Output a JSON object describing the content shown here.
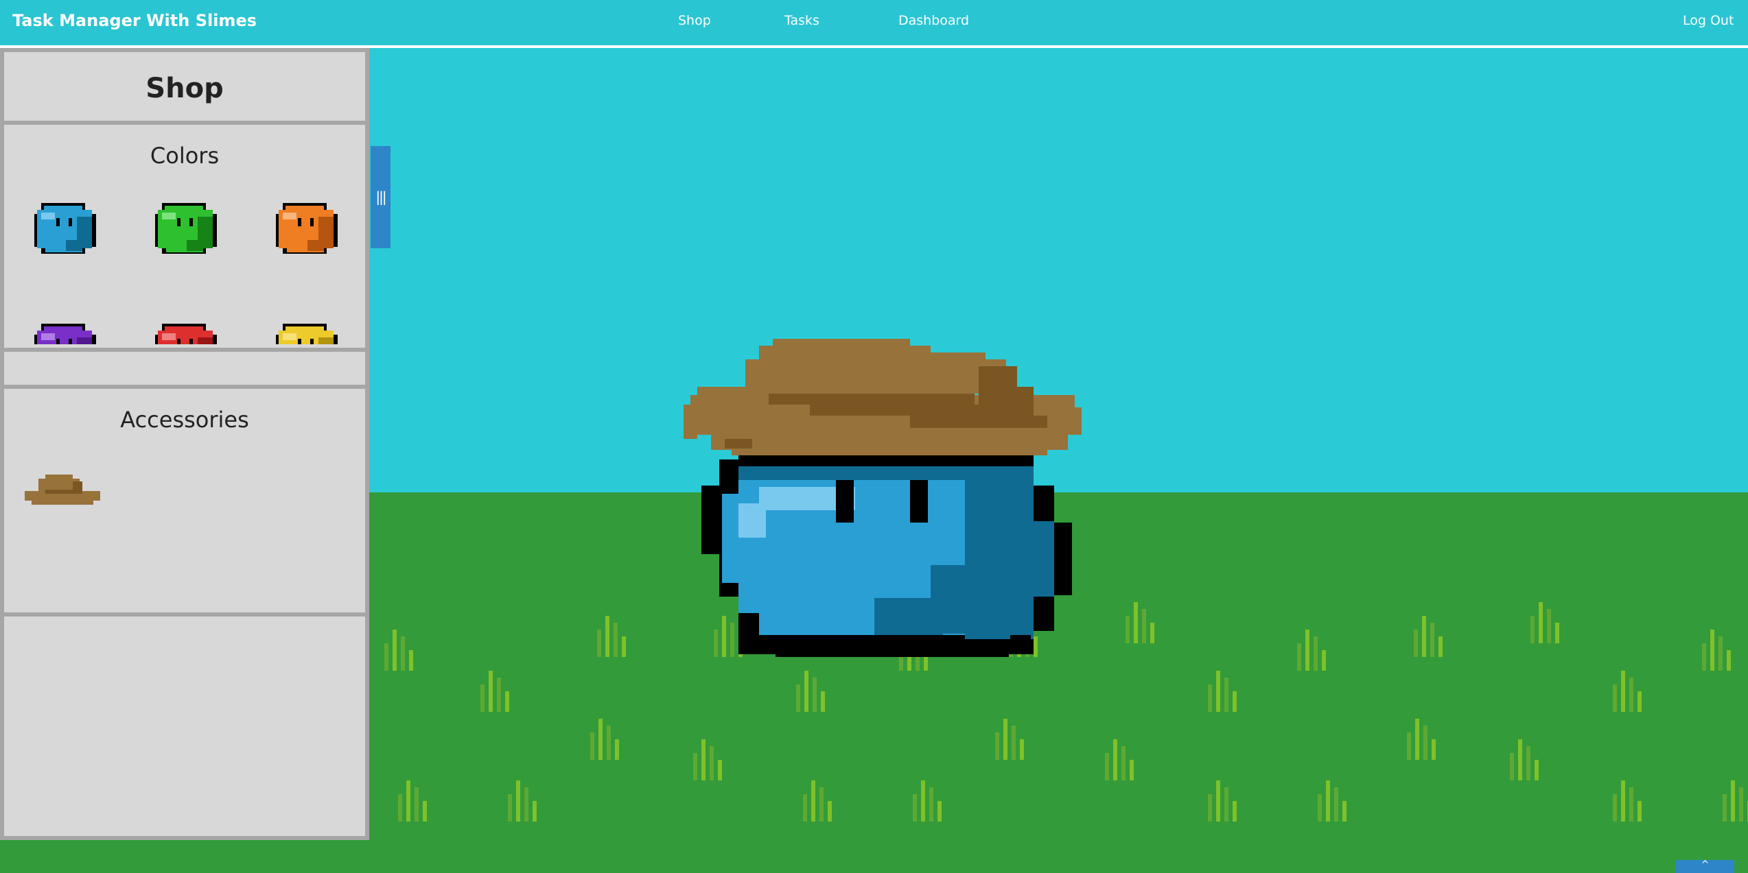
{
  "app": {
    "title": "Task Manager With Slimes"
  },
  "nav": {
    "shop": "Shop",
    "tasks": "Tasks",
    "dashboard": "Dashboard",
    "logout": "Log Out"
  },
  "shop_panel": {
    "title": "Shop",
    "colors_title": "Colors",
    "accessories_title": "Accessories",
    "colors": [
      {
        "name": "blue",
        "body": "#2a9fd4",
        "shade": "#106b93",
        "light": "#79c9ef"
      },
      {
        "name": "green",
        "body": "#2ec02e",
        "shade": "#168316",
        "light": "#7de37d"
      },
      {
        "name": "orange",
        "body": "#ef7d22",
        "shade": "#b4560f",
        "light": "#f7b57f"
      },
      {
        "name": "purple",
        "body": "#7a2fc8",
        "shade": "#52188f",
        "light": "#b07fe6"
      },
      {
        "name": "red",
        "body": "#de2f2f",
        "shade": "#9b1515",
        "light": "#f08181"
      },
      {
        "name": "yellow",
        "body": "#edcb2a",
        "shade": "#b39410",
        "light": "#f7e27a"
      }
    ],
    "accessories": [
      {
        "name": "cowboy-hat"
      }
    ]
  },
  "scene": {
    "slime_color": "#2a9fd4",
    "slime_shade": "#106b93",
    "slime_light": "#79c9ef",
    "hat_color": "#98723b",
    "hat_shade": "#7a5622",
    "sky_color": "#2acbd6",
    "grass_color": "#339b39"
  },
  "panel_handle_glyph": "|||",
  "scroll_top_glyph": "^"
}
